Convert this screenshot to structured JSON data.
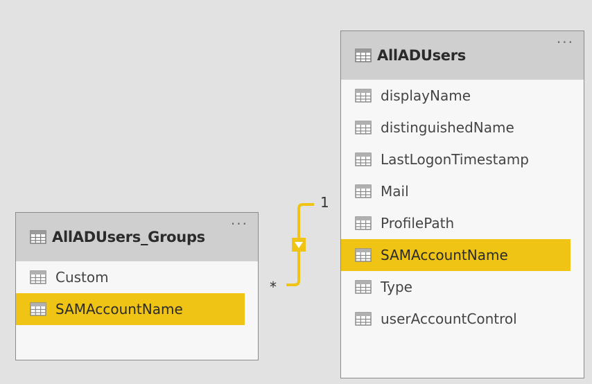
{
  "tables": {
    "groups": {
      "title": "AllADUsers_Groups",
      "more": "···",
      "fields": [
        "Custom",
        "SAMAccountName"
      ]
    },
    "users": {
      "title": "AllADUsers",
      "more": "···",
      "fields": [
        "displayName",
        "distinguishedName",
        "LastLogonTimestamp",
        "Mail",
        "ProfilePath",
        "SAMAccountName",
        "Type",
        "userAccountControl"
      ]
    }
  },
  "relationship": {
    "one_side": "1",
    "many_side": "*",
    "color": "#f0c415"
  },
  "icons": {
    "table": "table-grid-icon",
    "field": "table-grid-icon",
    "filter_direction": "filter-direction-icon"
  },
  "colors": {
    "background": "#e2e2e2",
    "header": "#cfcfcf",
    "selected": "#f0c415"
  }
}
